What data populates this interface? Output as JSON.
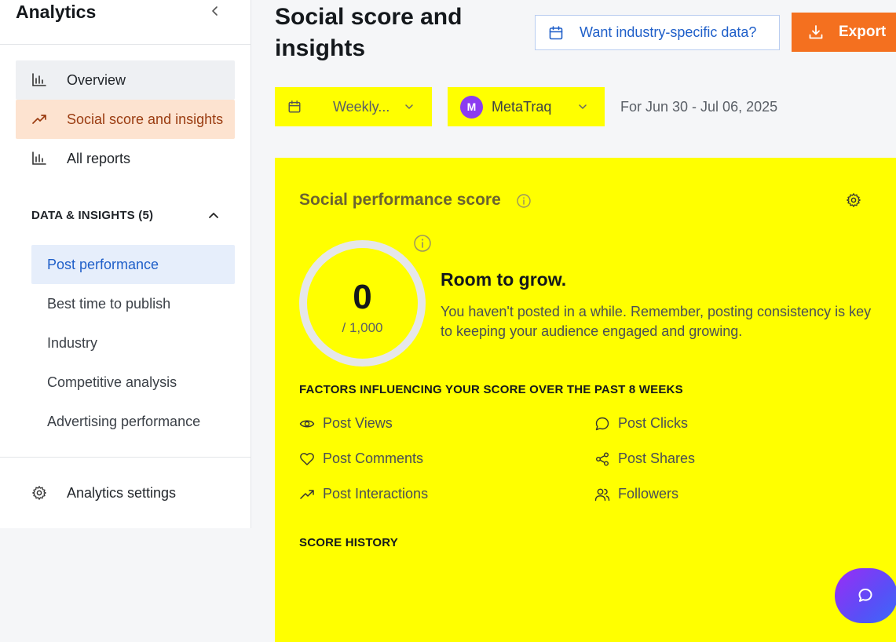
{
  "sidebar": {
    "title": "Analytics",
    "nav": [
      {
        "label": "Overview",
        "icon": "bar-chart-icon"
      },
      {
        "label": "Social score and insights",
        "icon": "trending-up-icon"
      },
      {
        "label": "All reports",
        "icon": "bar-chart-icon"
      }
    ],
    "section": {
      "label": "DATA & INSIGHTS (5)",
      "expanded": true
    },
    "sub_items": [
      {
        "label": "Post performance"
      },
      {
        "label": "Best time to publish"
      },
      {
        "label": "Industry"
      },
      {
        "label": "Competitive analysis"
      },
      {
        "label": "Advertising performance"
      }
    ],
    "settings_label": "Analytics settings"
  },
  "header": {
    "title": "Social score and insights",
    "industry_button": "Want industry-specific data?",
    "export_button": "Export"
  },
  "filters": {
    "period": "Weekly...",
    "account_initial": "M",
    "account": "MetaTraq",
    "date_range": "For Jun 30 - Jul 06, 2025"
  },
  "score_card": {
    "title": "Social performance score",
    "score": "0",
    "max": "/ 1,000",
    "headline": "Room to grow.",
    "description": "You haven't posted in a while. Remember, posting consistency is key to keeping your audience engaged and growing.",
    "factors_heading": "FACTORS INFLUENCING YOUR SCORE OVER THE PAST 8 WEEKS",
    "factors": [
      {
        "label": "Post Views",
        "icon": "eye-icon"
      },
      {
        "label": "Post Clicks",
        "icon": "chat-bubble-icon"
      },
      {
        "label": "Post Comments",
        "icon": "heart-icon"
      },
      {
        "label": "Post Shares",
        "icon": "share-icon"
      },
      {
        "label": "Post Interactions",
        "icon": "trending-up-icon"
      },
      {
        "label": "Followers",
        "icon": "users-icon"
      }
    ],
    "history_heading": "SCORE HISTORY"
  },
  "colors": {
    "highlight": "#ffff00",
    "export": "#f4701f",
    "link_blue": "#1f5fc9",
    "active_nav": "#fde3d0",
    "avatar": "#8b3cf0"
  }
}
